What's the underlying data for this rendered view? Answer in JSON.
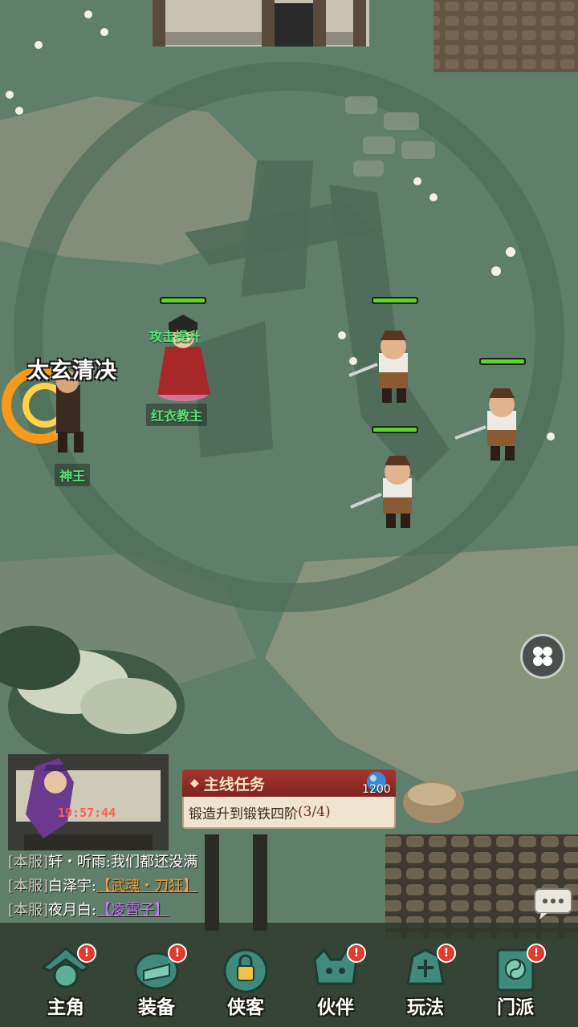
{
  "battle": {
    "skill_name": "太玄清决",
    "buff_label": "攻击提升",
    "hero_name": "神王",
    "ally_name": "红衣教主",
    "enemies_hp": [
      1.0,
      1.0,
      1.0
    ]
  },
  "quest": {
    "header": "主线任务",
    "bullet": "◆",
    "task": "锻造升到锻铁四阶",
    "progress": "(3/4)",
    "reward_amount": "1200"
  },
  "afk_timer": "19:57:44",
  "chat": [
    {
      "channel": "[本服]",
      "name": "轩・听雨",
      "sep": ":",
      "text": "我们都还没满",
      "text_color": "#ffffff"
    },
    {
      "channel": "[本服]",
      "name": "白泽宇",
      "sep": ":",
      "text": "【武魂・刀狂】",
      "text_color": "#f0a140"
    },
    {
      "channel": "[本服]",
      "name": "夜月白",
      "sep": ":",
      "text": "【凌霄子】",
      "text_color": "#c07cf2"
    }
  ],
  "nav": [
    {
      "label": "主角",
      "icon": "hero-icon",
      "badge": "!"
    },
    {
      "label": "装备",
      "icon": "equipment-icon",
      "badge": "!"
    },
    {
      "label": "侠客",
      "icon": "knight-icon",
      "badge": ""
    },
    {
      "label": "伙伴",
      "icon": "partner-icon",
      "badge": "!"
    },
    {
      "label": "玩法",
      "icon": "gameplay-icon",
      "badge": "!"
    },
    {
      "label": "门派",
      "icon": "sect-icon",
      "badge": "!"
    }
  ],
  "colors": {
    "ground": "#5f7f6a",
    "hp": "#5cd52e",
    "quest_header": "#a8352e",
    "badge": "#e23a2c"
  }
}
